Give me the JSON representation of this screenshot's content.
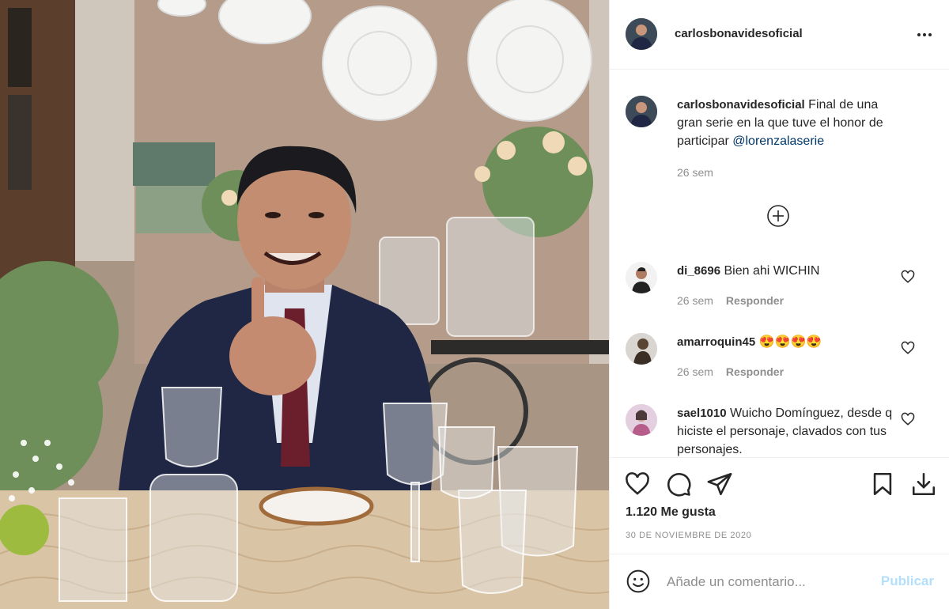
{
  "post": {
    "username": "carlosbonavidesoficial",
    "more_icon": "more-horizontal-icon"
  },
  "caption": {
    "username": "carlosbonavidesoficial",
    "text": " Final de una gran serie en la que tuve el honor de participar ",
    "mention": "@lorenzalaserie",
    "time": "26 sem"
  },
  "load_more_icon": "plus-circle-icon",
  "comments": [
    {
      "username": "di_8696",
      "text": " Bien ahi WICHIN",
      "time": "26 sem",
      "reply": "Responder"
    },
    {
      "username": "amarroquin45",
      "text": " 😍😍😍😍",
      "time": "26 sem",
      "reply": "Responder"
    },
    {
      "username": "sael1010",
      "text": " Wuicho Domínguez, desde q hiciste el personaje, clavados con tus personajes.",
      "time": "",
      "reply": ""
    }
  ],
  "actions": {
    "likes": "1.120 Me gusta",
    "date": "30 DE NOVIEMBRE DE 2020"
  },
  "add_comment": {
    "placeholder": "Añade un comentario...",
    "publish_label": "Publicar"
  },
  "colors": {
    "link": "#00376b",
    "muted": "#8e8e8e",
    "publish_disabled": "#b2dffc"
  }
}
